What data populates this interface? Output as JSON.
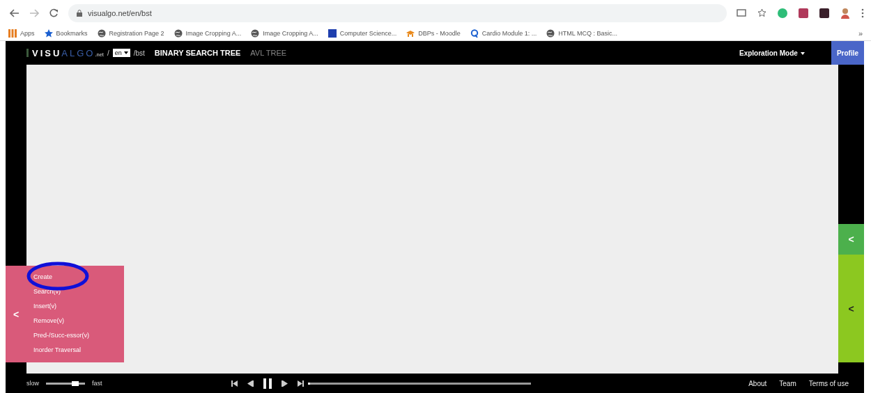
{
  "browser": {
    "address": "visualgo.net/en/bst",
    "bookmarks": [
      {
        "label": "Apps",
        "kind": "apps"
      },
      {
        "label": "Bookmarks",
        "kind": "star"
      },
      {
        "label": "Registration Page 2",
        "kind": "globe"
      },
      {
        "label": "Image Cropping A...",
        "kind": "globe"
      },
      {
        "label": "Image Cropping A...",
        "kind": "globe"
      },
      {
        "label": "Computer Science...",
        "kind": "square"
      },
      {
        "label": "DBPs - Moodle",
        "kind": "moodle"
      },
      {
        "label": "Cardio Module 1: ...",
        "kind": "q"
      },
      {
        "label": "HTML MCQ : Basic...",
        "kind": "globe"
      }
    ],
    "more": "»"
  },
  "header": {
    "logo_main": "VISU",
    "logo_accent": "ALGO",
    "logo_suffix": ".net",
    "separator": "/",
    "language": "en",
    "path": "/bst",
    "tabs": [
      {
        "label": "BINARY SEARCH TREE",
        "selected": true
      },
      {
        "label": "AVL TREE",
        "selected": false
      }
    ],
    "mode": "Exploration Mode",
    "profile": "Profile"
  },
  "left_panel": {
    "toggle": "<",
    "actions": [
      "Create",
      "Search(v)",
      "Insert(v)",
      "Remove(v)",
      "Pred-/Succ-essor(v)",
      "Inorder Traversal"
    ]
  },
  "right_panel": {
    "toggle_top": "<",
    "toggle_bottom": "<"
  },
  "footer": {
    "slow": "slow",
    "fast": "fast",
    "speed": {
      "level": 0.75
    },
    "progress": {
      "level": 0.0
    },
    "links": [
      "About",
      "Team",
      "Terms of use"
    ]
  }
}
